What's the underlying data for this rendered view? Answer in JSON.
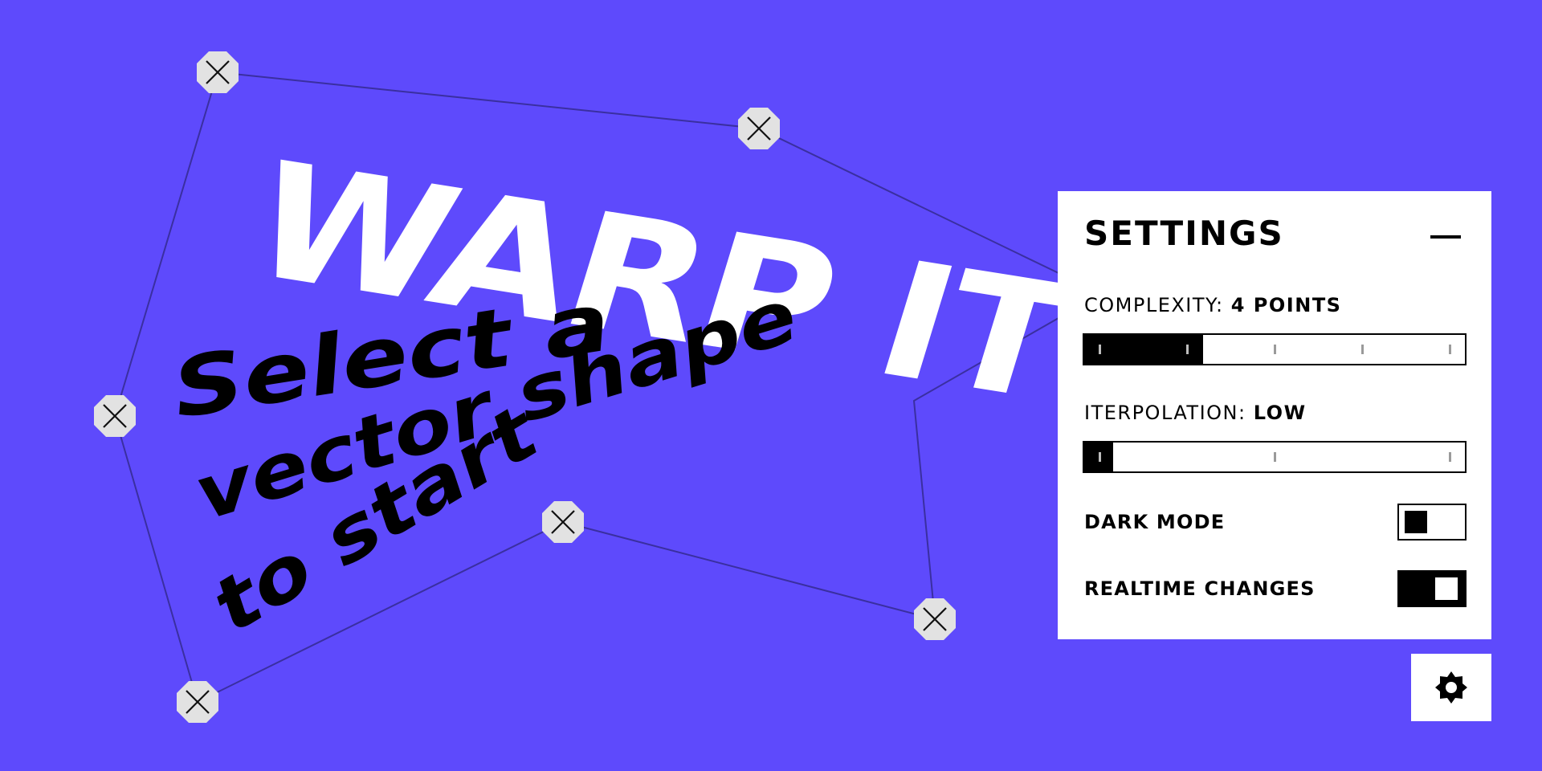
{
  "canvas": {
    "title": "WARP IT",
    "instruction_lines": [
      "Select a",
      "vector shape",
      "to start"
    ]
  },
  "settings": {
    "title": "SETTINGS",
    "complexity": {
      "label": "COMPLEXITY:",
      "value": "4 POINTS",
      "level_fraction": 0.3125,
      "ticks": 5
    },
    "interpolation": {
      "label": "ITERPOLATION:",
      "value": "LOW",
      "level_fraction": 0.075,
      "ticks": 3
    },
    "dark_mode": {
      "label": "DARK MODE",
      "on": false
    },
    "realtime_changes": {
      "label": "REALTIME CHANGES",
      "on": true
    }
  },
  "icons": {
    "collapse": "minus-icon",
    "settings": "gear-icon",
    "handle": "close-icon"
  },
  "colors": {
    "background": "#5e4afc",
    "panel": "#ffffff",
    "accent": "#000000",
    "handle": "#e2e2e2"
  }
}
